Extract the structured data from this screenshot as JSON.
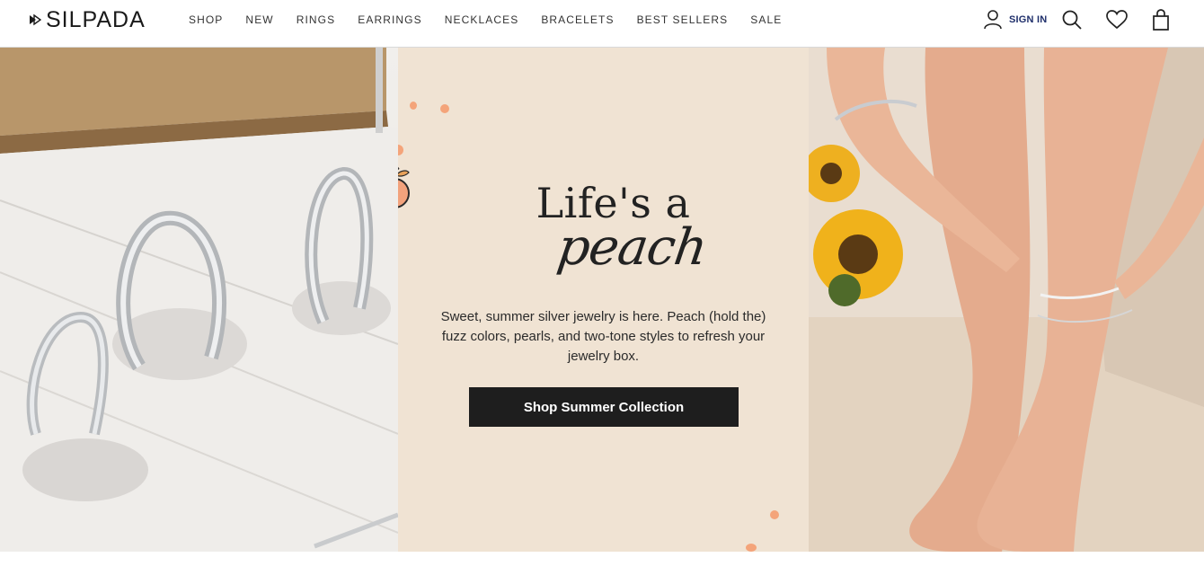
{
  "brand": {
    "name": "SILPADA"
  },
  "nav": {
    "items": [
      {
        "label": "SHOP"
      },
      {
        "label": "NEW"
      },
      {
        "label": "RINGS"
      },
      {
        "label": "EARRINGS"
      },
      {
        "label": "NECKLACES"
      },
      {
        "label": "BRACELETS"
      },
      {
        "label": "BEST SELLERS"
      },
      {
        "label": "SALE"
      }
    ]
  },
  "utility": {
    "signin_label": "SIGN IN",
    "icons": [
      "user-icon",
      "search-icon",
      "heart-icon",
      "shopping-bag-icon"
    ]
  },
  "hero": {
    "headline_line1": "Life's a",
    "headline_line2": "peach",
    "description": "Sweet, summer silver jewelry is here. Peach (hold the) fuzz colors, pearls, and two-tone styles to refresh your jewelry box.",
    "cta_label": "Shop Summer Collection"
  },
  "colors": {
    "accent_dark": "#1e1e1e",
    "signin_blue": "#1f2f6b",
    "hero_background": "#f0e3d3",
    "peach": "#f4a47a"
  }
}
